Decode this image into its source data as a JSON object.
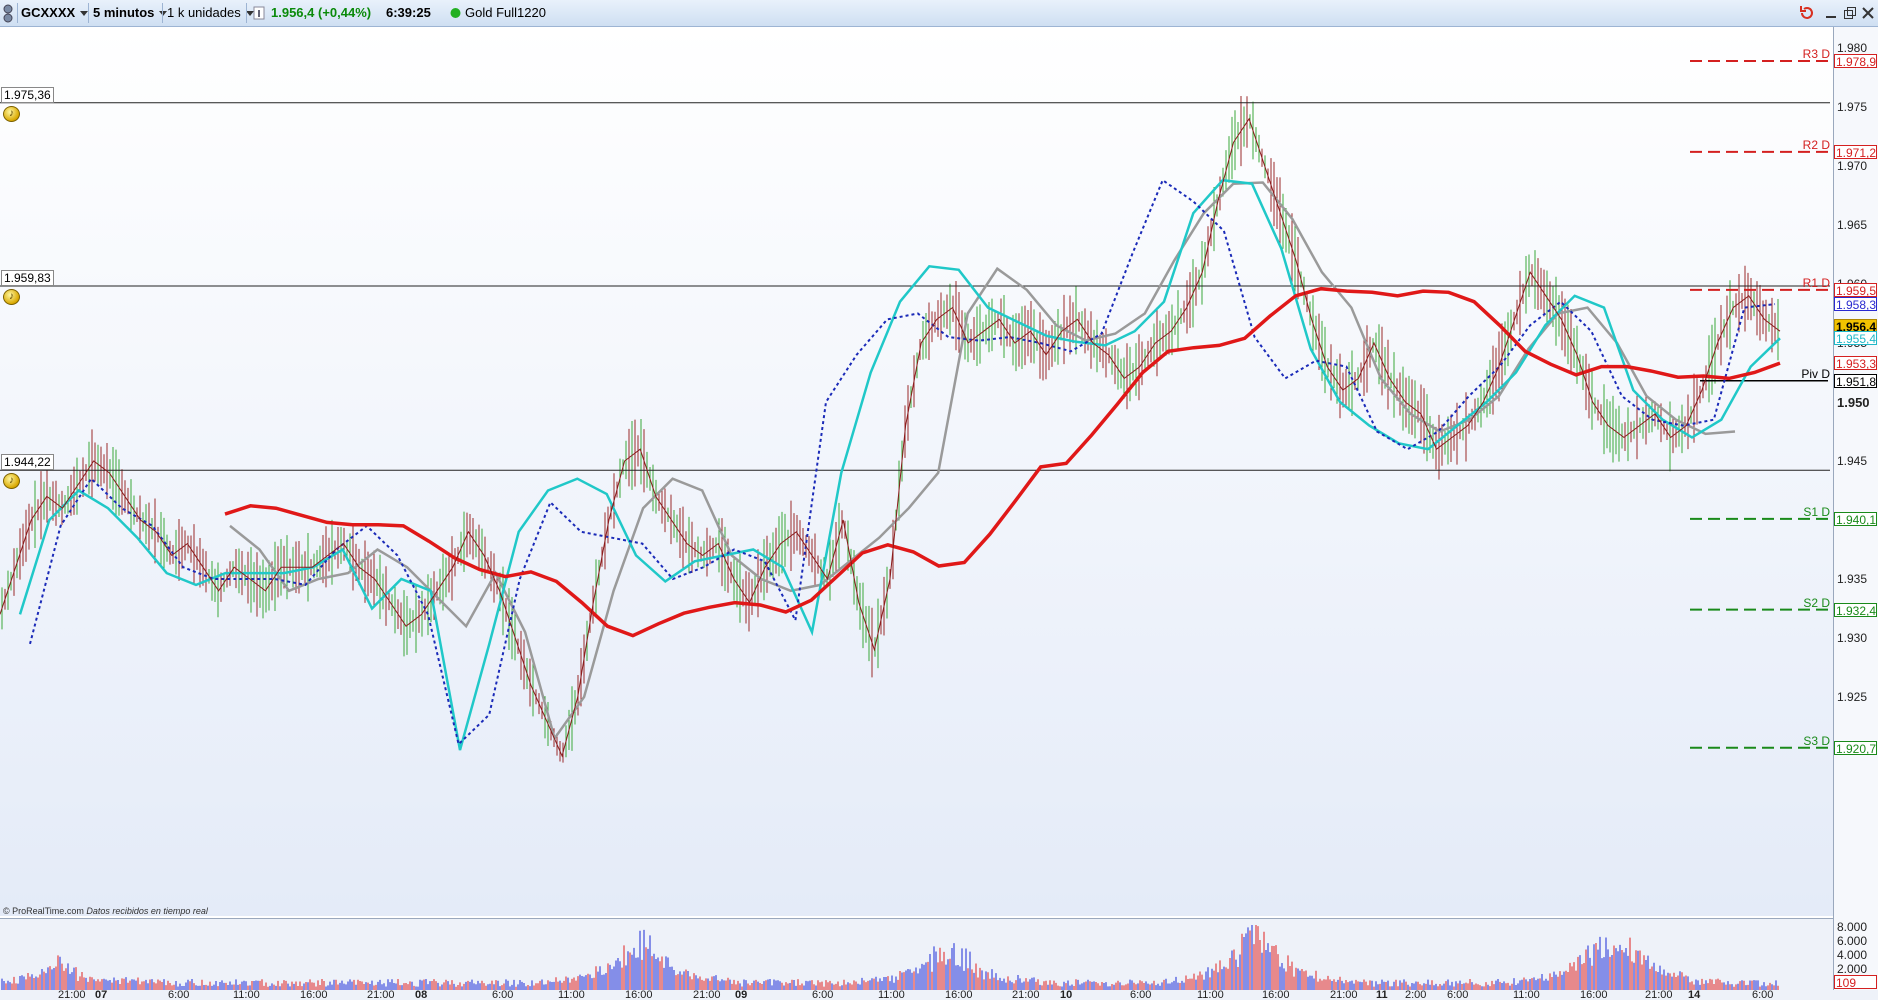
{
  "toolbar": {
    "symbol": "GCXXXX",
    "timeframe": "5 minutos",
    "units": "1 k unidades",
    "price_change": "1.956,4 (+0,44%)",
    "time": "6:39:25",
    "instrument": "Gold Full1220",
    "colors": {
      "positive": "#0a8a0a",
      "status_dot": "#22b022"
    }
  },
  "credit": {
    "brand": "© ProRealTime.com",
    "note": "Datos recibidos en tiempo real"
  },
  "price_axis": {
    "ticks": [
      "1.980",
      "1.975",
      "1.970",
      "1.965",
      "1.960",
      "1.955",
      "1.950",
      "1.945",
      "1.940",
      "1.935",
      "1.930",
      "1.925"
    ],
    "bold_tick": "1.950"
  },
  "horizontal_lines": [
    {
      "label": "1.975,36",
      "price": 1975.36
    },
    {
      "label": "1.959,83",
      "price": 1959.83
    },
    {
      "label": "1.944,22",
      "price": 1944.22
    }
  ],
  "pivots": [
    {
      "name": "R3 D",
      "value": "1.978,9",
      "price": 1978.9,
      "color": "#d42020",
      "line": "dashed"
    },
    {
      "name": "R2 D",
      "value": "1.971,2",
      "price": 1971.2,
      "color": "#d42020",
      "line": "dashed"
    },
    {
      "name": "R1 D",
      "value": "1.959,5",
      "price": 1959.5,
      "color": "#d42020",
      "line": "dashed"
    },
    {
      "name": "Piv D",
      "value": "1.951,8",
      "price": 1951.8,
      "color": "#000000",
      "line": "solid"
    },
    {
      "name": "S1 D",
      "value": "1.940,1",
      "price": 1940.1,
      "color": "#1a8a1a",
      "line": "dashed"
    },
    {
      "name": "S2 D",
      "value": "1.932,4",
      "price": 1932.4,
      "color": "#1a8a1a",
      "line": "dashed"
    },
    {
      "name": "S3 D",
      "value": "1.920,7",
      "price": 1920.7,
      "color": "#1a8a1a",
      "line": "dashed"
    }
  ],
  "price_badges": [
    {
      "value": "1.958,3",
      "price": 1958.3,
      "color": "#2a2ad0",
      "bg": "#ffffff"
    },
    {
      "value": "1.956,4",
      "price": 1956.4,
      "color": "#000000",
      "bg": "#f2c200"
    },
    {
      "value": "1.955,4",
      "price": 1955.4,
      "color": "#20b8c8",
      "bg": "#ffffff"
    },
    {
      "value": "1.953,3",
      "price": 1953.3,
      "color": "#d42020",
      "bg": "#ffffff"
    }
  ],
  "volume_axis": {
    "ticks": [
      "8.000",
      "6.000",
      "4.000",
      "2.000"
    ],
    "current": "109"
  },
  "time_axis": [
    {
      "label": "21:00",
      "day": false
    },
    {
      "label": "07",
      "day": true
    },
    {
      "label": "6:00",
      "day": false
    },
    {
      "label": "11:00",
      "day": false
    },
    {
      "label": "16:00",
      "day": false
    },
    {
      "label": "21:00",
      "day": false
    },
    {
      "label": "08",
      "day": true
    },
    {
      "label": "6:00",
      "day": false
    },
    {
      "label": "11:00",
      "day": false
    },
    {
      "label": "16:00",
      "day": false
    },
    {
      "label": "21:00",
      "day": false
    },
    {
      "label": "09",
      "day": true
    },
    {
      "label": "6:00",
      "day": false
    },
    {
      "label": "11:00",
      "day": false
    },
    {
      "label": "16:00",
      "day": false
    },
    {
      "label": "21:00",
      "day": false
    },
    {
      "label": "10",
      "day": true
    },
    {
      "label": "6:00",
      "day": false
    },
    {
      "label": "11:00",
      "day": false
    },
    {
      "label": "16:00",
      "day": false
    },
    {
      "label": "21:00",
      "day": false
    },
    {
      "label": "11",
      "day": true
    },
    {
      "label": "2:00",
      "day": false
    },
    {
      "label": "6:00",
      "day": false
    },
    {
      "label": "11:00",
      "day": false
    },
    {
      "label": "16:00",
      "day": false
    },
    {
      "label": "21:00",
      "day": false
    },
    {
      "label": "14",
      "day": true
    },
    {
      "label": "6:00",
      "day": false
    }
  ],
  "chart_data": {
    "type": "line",
    "ylim": [
      1918,
      1982
    ],
    "price_series": [
      1932,
      1936,
      1940,
      1942,
      1941,
      1943,
      1945,
      1944,
      1942,
      1940,
      1939,
      1937,
      1938,
      1936,
      1934,
      1936,
      1935,
      1934,
      1936,
      1936,
      1936,
      1937,
      1938,
      1936,
      1935,
      1933,
      1931,
      1932,
      1934,
      1936,
      1939,
      1937,
      1934,
      1930,
      1926,
      1923,
      1920,
      1925,
      1933,
      1940,
      1945,
      1946,
      1942,
      1940,
      1938,
      1937,
      1938,
      1935,
      1933,
      1936,
      1938,
      1939,
      1937,
      1935,
      1940,
      1933,
      1929,
      1935,
      1948,
      1955,
      1957,
      1958,
      1955,
      1956,
      1957,
      1955,
      1956,
      1954,
      1956,
      1957,
      1955,
      1954,
      1952,
      1953,
      1955,
      1956,
      1958,
      1961,
      1967,
      1972,
      1974,
      1970,
      1966,
      1962,
      1957,
      1953,
      1951,
      1952,
      1955,
      1952,
      1950,
      1949,
      1946,
      1947,
      1948,
      1950,
      1953,
      1957,
      1961,
      1959,
      1957,
      1954,
      1950,
      1948,
      1947,
      1948,
      1949,
      1947,
      1948,
      1951,
      1955,
      1958,
      1959,
      1957,
      1956
    ],
    "sma_red": [
      1940.5,
      1941.2,
      1941.0,
      1940.4,
      1939.8,
      1939.6,
      1939.6,
      1939.5,
      1938.2,
      1936.8,
      1935.8,
      1935.2,
      1935.6,
      1934.8,
      1933.0,
      1931.0,
      1930.2,
      1931.2,
      1932.1,
      1932.6,
      1933.0,
      1932.8,
      1932.2,
      1933.2,
      1935.2,
      1937.2,
      1937.9,
      1937.3,
      1936.1,
      1936.4,
      1938.8,
      1941.6,
      1944.5,
      1944.8,
      1947.2,
      1949.8,
      1952.5,
      1954.3,
      1954.6,
      1954.8,
      1955.4,
      1957.3,
      1959.0,
      1959.6,
      1959.4,
      1959.3,
      1959.0,
      1959.4,
      1959.3,
      1958.5,
      1956.5,
      1954.3,
      1953.2,
      1952.3,
      1953.0,
      1953.0,
      1952.6,
      1952.1,
      1952.2,
      1952.0,
      1952.5,
      1953.3
    ],
    "avg_cyan": [
      1932.0,
      1940.0,
      1942.5,
      1941.0,
      1938.5,
      1935.5,
      1934.5,
      1935.5,
      1935.5,
      1935.5,
      1936.0,
      1937.5,
      1932.5,
      1935.0,
      1934.0,
      1920.5,
      1929.5,
      1939.0,
      1942.5,
      1943.5,
      1942.2,
      1937.0,
      1934.8,
      1936.5,
      1937.0,
      1937.5,
      1936.0,
      1930.5,
      1944.0,
      1952.5,
      1958.5,
      1961.5,
      1961.2,
      1958.0,
      1956.8,
      1955.6,
      1955.1,
      1954.8,
      1956.0,
      1958.5,
      1966.0,
      1968.8,
      1968.5,
      1963.0,
      1954.5,
      1950.0,
      1948.0,
      1946.5,
      1946.0,
      1948.0,
      1950.0,
      1952.5,
      1956.5,
      1959.0,
      1958.0,
      1951.0,
      1948.5,
      1947.0,
      1948.5,
      1953.0,
      1955.4
    ],
    "ma_blue_dotted": [
      1929.5,
      1939.5,
      1943.5,
      1941.0,
      1939.5,
      1936.0,
      1935.0,
      1935.0,
      1935.0,
      1934.5,
      1937.5,
      1939.5,
      1937.0,
      1932.0,
      1921.0,
      1923.5,
      1935.0,
      1941.5,
      1939.0,
      1938.5,
      1938.0,
      1935.0,
      1936.0,
      1937.5,
      1936.5,
      1931.5,
      1950.0,
      1954.0,
      1957.0,
      1957.5,
      1955.5,
      1955.2,
      1955.5,
      1955.0,
      1954.3,
      1955.8,
      1962.5,
      1968.8,
      1967.0,
      1964.5,
      1955.5,
      1952.0,
      1953.5,
      1953.0,
      1947.5,
      1946.0,
      1947.5,
      1950.5,
      1953.0,
      1956.5,
      1958.5,
      1956.0,
      1950.5,
      1948.5,
      1948.0,
      1948.5,
      1958.0,
      1958.3
    ],
    "avg_gray": [
      1939.5,
      1937.5,
      1934.0,
      1935.0,
      1935.5,
      1937.5,
      1936.0,
      1933.5,
      1931.0,
      1935.5,
      1930.5,
      1921.5,
      1925.0,
      1934.0,
      1941.0,
      1943.5,
      1942.5,
      1937.0,
      1935.0,
      1934.0,
      1934.5,
      1936.5,
      1938.5,
      1941.0,
      1944.0,
      1957.5,
      1961.3,
      1959.5,
      1956.5,
      1955.2,
      1955.8,
      1957.5,
      1962.0,
      1966.0,
      1968.5,
      1968.6,
      1965.5,
      1961.0,
      1958.0,
      1952.0,
      1949.0,
      1947.5,
      1948.5,
      1950.5,
      1954.5,
      1957.5,
      1958.0,
      1955.0,
      1950.5,
      1948.5,
      1947.3,
      1947.5
    ],
    "volume_axis_max": 8000
  }
}
